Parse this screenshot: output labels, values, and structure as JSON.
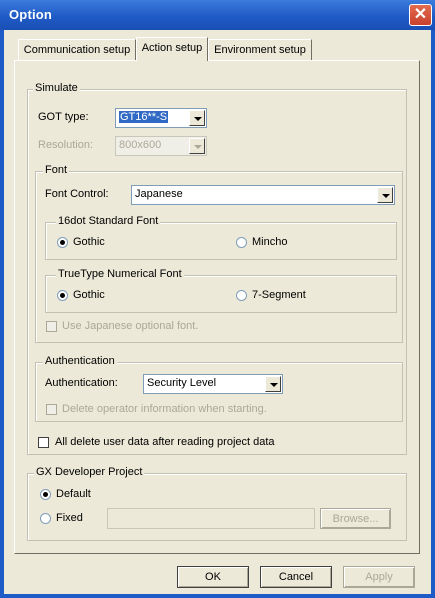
{
  "window": {
    "title": "Option",
    "close_glyph": "✕"
  },
  "tabs": [
    {
      "label": "Communication setup"
    },
    {
      "label": "Action setup"
    },
    {
      "label": "Environment setup"
    }
  ],
  "simulate": {
    "legend": "Simulate",
    "got_type_label": "GOT type:",
    "got_type_value": "GT16**-S",
    "resolution_label": "Resolution:",
    "resolution_value": "800x600"
  },
  "font": {
    "legend": "Font",
    "control_label": "Font Control:",
    "control_value": "Japanese",
    "standard": {
      "legend": "16dot Standard Font",
      "opt1": "Gothic",
      "opt2": "Mincho"
    },
    "truetype": {
      "legend": "TrueType Numerical Font",
      "opt1": "Gothic",
      "opt2": "7-Segment"
    },
    "optional_label": "Use Japanese optional font."
  },
  "auth": {
    "legend": "Authentication",
    "label": "Authentication:",
    "value": "Security Level",
    "delete_label": "Delete operator information when starting."
  },
  "all_delete_label": "All delete user data after reading project data",
  "gx": {
    "legend": "GX Developer Project",
    "default_label": "Default",
    "fixed_label": "Fixed",
    "browse_label": "Browse..."
  },
  "buttons": {
    "ok": "OK",
    "cancel": "Cancel",
    "apply": "Apply"
  }
}
